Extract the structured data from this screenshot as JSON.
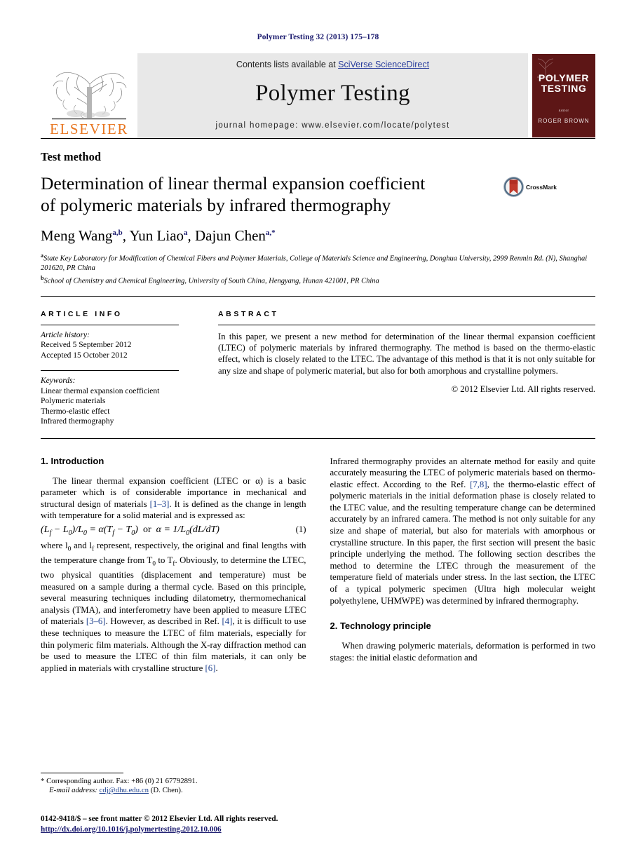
{
  "running_head": "Polymer Testing 32 (2013) 175–178",
  "banner": {
    "publisher_name": "ELSEVIER",
    "contents_prefix": "Contents lists available at ",
    "contents_link": "SciVerse ScienceDirect",
    "journal_title": "Polymer Testing",
    "homepage": "journal homepage: www.elsevier.com/locate/polytest",
    "cover": {
      "title_line1": "POLYMER",
      "title_line2": "TESTING",
      "editor_label": "Editor",
      "editor_name": "ROGER BROWN"
    }
  },
  "article": {
    "doctype": "Test method",
    "title_line1": "Determination of linear thermal expansion coefficient",
    "title_line2": "of polymeric materials by infrared thermography",
    "crossmark_label": "CrossMark",
    "authors": [
      {
        "name": "Meng Wang",
        "sup": "a,b",
        "sep": ", "
      },
      {
        "name": "Yun Liao",
        "sup": "a",
        "sep": ", "
      },
      {
        "name": "Dajun Chen",
        "sup": "a,*",
        "sep": ""
      }
    ],
    "affiliations": [
      {
        "marker": "a",
        "text": "State Key Laboratory for Modification of Chemical Fibers and Polymer Materials, College of Materials Science and Engineering, Donghua University, 2999 Renmin Rd. (N), Shanghai 201620, PR China"
      },
      {
        "marker": "b",
        "text": "School of Chemistry and Chemical Engineering, University of South China, Hengyang, Hunan 421001, PR China"
      }
    ]
  },
  "article_info": {
    "heading": "ARTICLE INFO",
    "history_label": "Article history:",
    "history": [
      "Received 5 September 2012",
      "Accepted 15 October 2012"
    ],
    "keywords_label": "Keywords:",
    "keywords": [
      "Linear thermal expansion coefficient",
      "Polymeric materials",
      "Thermo-elastic effect",
      "Infrared thermography"
    ]
  },
  "abstract": {
    "heading": "ABSTRACT",
    "text": "In this paper, we present a new method for determination of the linear thermal expansion coefficient (LTEC) of polymeric materials by infrared thermography. The method is based on the thermo-elastic effect, which is closely related to the LTEC. The advantage of this method is that it is not only suitable for any size and shape of polymeric material, but also for both amorphous and crystalline polymers.",
    "copyright": "© 2012 Elsevier Ltd. All rights reserved."
  },
  "body": {
    "section1_heading": "1. Introduction",
    "para1_a": "The linear thermal expansion coefficient (LTEC or α) is a basic parameter which is of considerable importance in mechanical and structural design of materials ",
    "para1_ref": "[1–3]",
    "para1_b": ". It is defined as the change in length with temperature for a solid material and is expressed as:",
    "equation": "(L_f − L_0)/L_0 = α(T_f − T_0)   or   α = 1/L_0(dL/dT)",
    "equation_number": "(1)",
    "para2_a": "where l",
    "para2_b": " and l",
    "para2_c": " represent, respectively, the original and final lengths with the temperature change from T",
    "para2_d": " to T",
    "para2_e": ". Obviously, to determine the LTEC, two physical quantities (displacement and temperature) must be measured on a sample during a thermal cycle. Based on this principle, several measuring techniques including dilatometry, thermomechanical analysis (TMA), and interferometry have been applied to measure LTEC of materials ",
    "para2_ref1": "[3–6]",
    "para2_f": ". However, as described in Ref. ",
    "para2_ref2": "[4]",
    "para2_g": ", it is difficult to use these techniques to measure the LTEC of film materials, especially for thin polymeric film materials. Although the X-ray diffraction method can be used to measure the LTEC of thin film materials, it can only be applied in materials with crystalline structure ",
    "para2_ref3": "[6]",
    "para2_h": ".",
    "para3_a": "Infrared thermography provides an alternate method for easily and quite accurately measuring the LTEC of polymeric materials based on thermo-elastic effect. According to the Ref. ",
    "para3_ref": "[7,8]",
    "para3_b": ", the thermo-elastic effect of polymeric materials in the initial deformation phase is closely related to the LTEC value, and the resulting temperature change can be determined accurately by an infrared camera. The method is not only suitable for any size and shape of material, but also for materials with amorphous or crystalline structure. In this paper, the first section will present the basic principle underlying the method. The following section describes the method to determine the LTEC through the measurement of the temperature field of materials under stress. In the last section, the LTEC of a typical polymeric specimen (Ultra high molecular weight polyethylene, UHMWPE) was determined by infrared thermography.",
    "section2_heading": "2. Technology principle",
    "para4": "When drawing polymeric materials, deformation is performed in two stages: the initial elastic deformation and"
  },
  "footnote": {
    "star": "*",
    "corresponding": " Corresponding author. Fax: +86 (0) 21 67792891.",
    "email_label": "E-mail address:",
    "email": "cdj@dhu.edu.cn",
    "email_suffix": " (D. Chen)."
  },
  "bottom": {
    "issn_line": "0142-9418/$ – see front matter © 2012 Elsevier Ltd. All rights reserved.",
    "doi": "http://dx.doi.org/10.1016/j.polymertesting.2012.10.006"
  },
  "colors": {
    "link_blue": "#1a3e8c",
    "running_head_blue": "#1a1a6e",
    "elsevier_orange": "#E87722",
    "cover_maroon": "#5d1616",
    "banner_gray": "#e8e8e8"
  }
}
